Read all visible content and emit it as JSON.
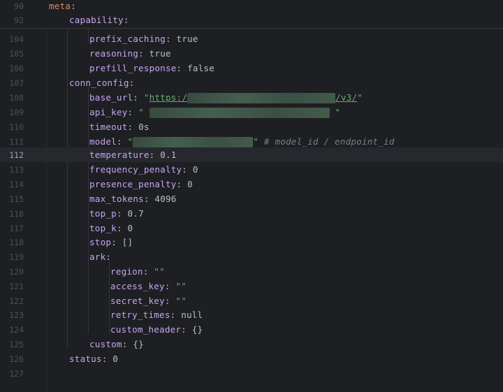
{
  "sticky": [
    {
      "ln": "90",
      "key": "meta"
    },
    {
      "ln": "92",
      "key": "capability"
    }
  ],
  "lines": [
    {
      "ln": "104",
      "key": "prefix_caching",
      "value": "true"
    },
    {
      "ln": "105",
      "key": "reasoning",
      "value": "true"
    },
    {
      "ln": "106",
      "key": "prefill_response",
      "value": "false"
    },
    {
      "ln": "107",
      "key": "conn_config"
    },
    {
      "ln": "108",
      "key": "base_url",
      "url_start": "https:/",
      "url_end": "/v3/"
    },
    {
      "ln": "109",
      "key": "api_key"
    },
    {
      "ln": "110",
      "key": "timeout",
      "value": "0s"
    },
    {
      "ln": "111",
      "key": "model",
      "comment": "# model_id / endpoint_id"
    },
    {
      "ln": "112",
      "key": "temperature",
      "value": "0.1"
    },
    {
      "ln": "113",
      "key": "frequency_penalty",
      "value": "0"
    },
    {
      "ln": "114",
      "key": "presence_penalty",
      "value": "0"
    },
    {
      "ln": "115",
      "key": "max_tokens",
      "value": "4096"
    },
    {
      "ln": "116",
      "key": "top_p",
      "value": "0.7"
    },
    {
      "ln": "117",
      "key": "top_k",
      "value": "0"
    },
    {
      "ln": "118",
      "key": "stop",
      "value": "[]"
    },
    {
      "ln": "119",
      "key": "ark"
    },
    {
      "ln": "120",
      "key": "region",
      "value": "\"\""
    },
    {
      "ln": "121",
      "key": "access_key",
      "value": "\"\""
    },
    {
      "ln": "122",
      "key": "secret_key",
      "value": "\"\""
    },
    {
      "ln": "123",
      "key": "retry_times",
      "value": "null"
    },
    {
      "ln": "124",
      "key": "custom_header",
      "value": "{}"
    },
    {
      "ln": "125",
      "key": "custom",
      "value": "{}"
    },
    {
      "ln": "126",
      "key": "status",
      "value": "0"
    },
    {
      "ln": "127"
    }
  ],
  "colors": {
    "background": "#1e1f22",
    "key": "#c7a4f2",
    "string": "#6aab73",
    "comment": "#7a7e85"
  }
}
